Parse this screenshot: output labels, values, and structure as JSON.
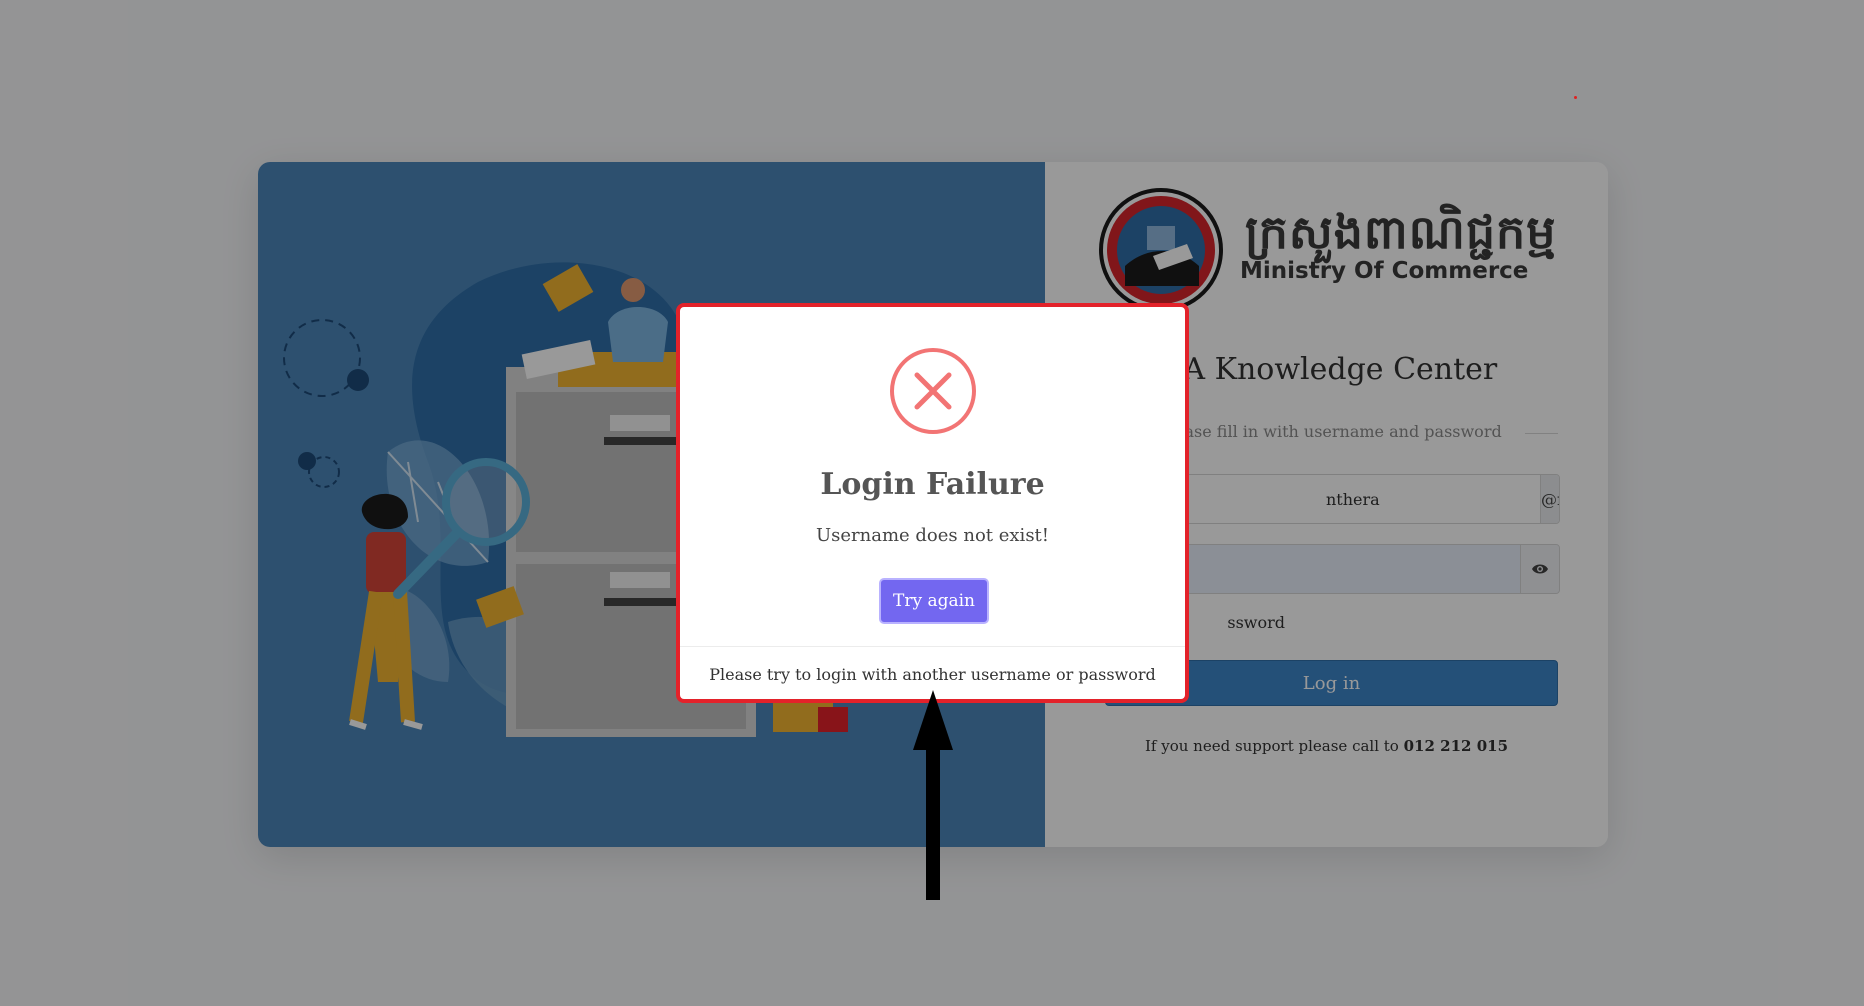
{
  "login": {
    "logo_khmer": "ក្រសួងពាណិជ្ជកម្ម",
    "logo_english": "Ministry Of Commerce",
    "app_title": "TA Knowledge Center",
    "subtitle": "ease fill in with username and password",
    "username_value": "nthera",
    "username_suffix": "@moc.gov.kh",
    "forgot_label": "ssword",
    "login_button": "Log in",
    "support_text": "If you need support please call to",
    "support_phone": "012 212 015"
  },
  "modal": {
    "icon": "error-x-circle-icon",
    "title": "Login Failure",
    "message": "Username does not exist!",
    "button_label": "Try again",
    "footer": "Please try to login with another username or password"
  },
  "annotation": {
    "icon": "up-arrow-icon"
  },
  "colors": {
    "modal_border": "#e3222a",
    "try_button": "#7367f0",
    "login_button": "#3c85c8",
    "left_panel": "#4b86b9",
    "error_icon": "#f27474"
  }
}
